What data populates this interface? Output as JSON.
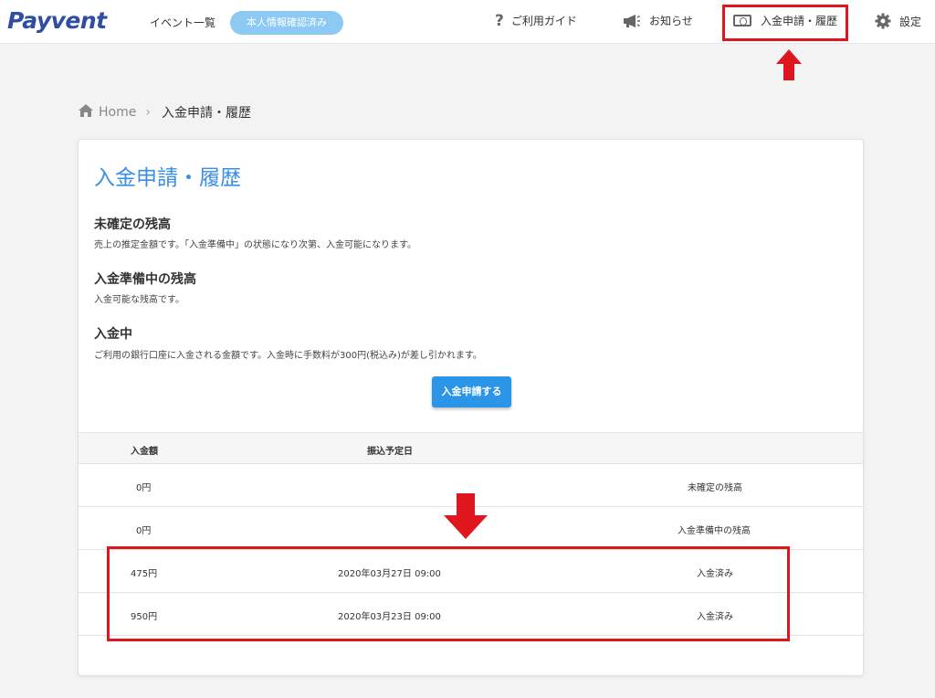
{
  "header": {
    "logo": "Payvent",
    "nav_events": "イベント一覧",
    "verified_badge": "本人情報確認済み",
    "guide": "ご利用ガイド",
    "news": "お知らせ",
    "deposit": "入金申請・履歴",
    "settings": "設定"
  },
  "breadcrumb": {
    "home": "Home",
    "current": "入金申請・履歴"
  },
  "page": {
    "title": "入金申請・履歴",
    "sections": [
      {
        "heading": "未確定の残高",
        "description": "売上の推定金額です。「入金準備中」の状態になり次第、入金可能になります。"
      },
      {
        "heading": "入金準備中の残高",
        "description": "入金可能な残高です。"
      },
      {
        "heading": "入金中",
        "description": "ご利用の銀行口座に入金される金額です。入金時に手数料が300円(税込み)が差し引かれます。"
      }
    ],
    "deposit_button": "入金申請する"
  },
  "table": {
    "headers": [
      "入金額",
      "振込予定日"
    ],
    "rows": [
      {
        "amount": "0円",
        "date": "",
        "status": "未確定の残高"
      },
      {
        "amount": "0円",
        "date": "",
        "status": "入金準備中の残高"
      },
      {
        "amount": "475円",
        "date": "2020年03月27日 09:00",
        "status": "入金済み"
      },
      {
        "amount": "950円",
        "date": "2020年03月23日 09:00",
        "status": "入金済み"
      }
    ]
  },
  "colors": {
    "accent": "#3a8ee6",
    "button": "#2b96e8",
    "badge": "#8ccaf3",
    "logo": "#2f4ea3",
    "annotation": "#e0161e"
  },
  "icons": {
    "guide": "question-icon",
    "news": "megaphone-icon",
    "deposit": "cash-icon",
    "settings": "gear-icon",
    "breadcrumb_home": "home-icon",
    "breadcrumb_sep": "chevron-right-icon"
  }
}
